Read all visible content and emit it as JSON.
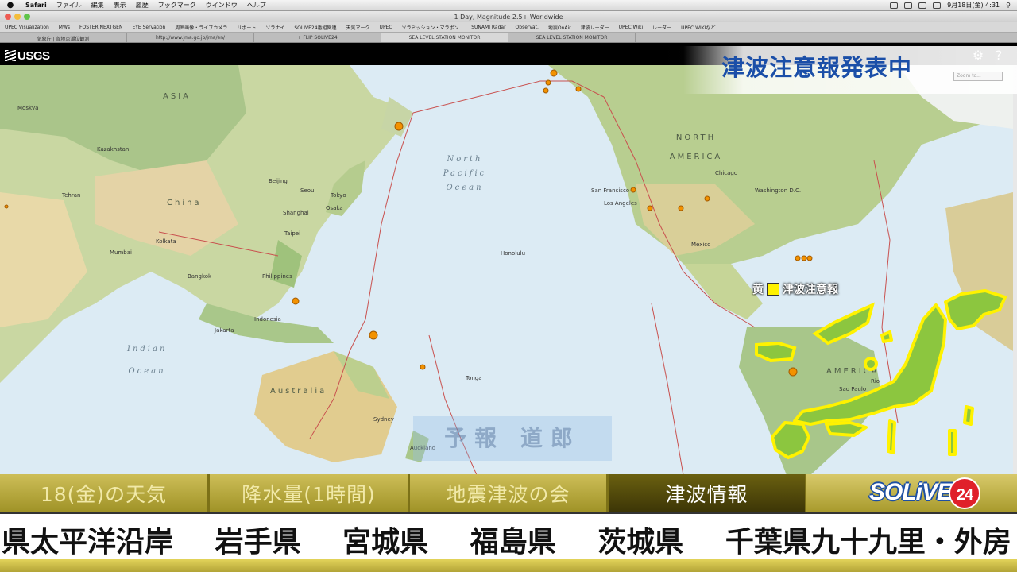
{
  "menubar": {
    "app": "Safari",
    "items": [
      "ファイル",
      "編集",
      "表示",
      "履歴",
      "ブックマーク",
      "ウインドウ",
      "ヘルプ"
    ],
    "clock": "9月18日(金) 4:31"
  },
  "window": {
    "title": "1 Day, Magnitude 2.5+ Worldwide"
  },
  "bookmarks": [
    "UPEC Visualization",
    "MWs",
    "FOSTER NEXTGEN",
    "EYE Servation",
    "周囲画像・ライブカメラ",
    "リポート",
    "ソラナイ",
    "SOLIVE24番組関連",
    "天気マーク",
    "UPEC",
    "ソラミッション・マラポン",
    "TSUNAMI Radar",
    "Observat.",
    "地震OnAir",
    "津波レーダー",
    "UPEC Wiki",
    "レーダー",
    "UPEC WIKIなど"
  ],
  "tabs": [
    "気象庁 | 各地点潮位観測",
    "http://www.jma.go.jp/jma/en/",
    "+ FLIP SOLIVE24",
    "SEA LEVEL STATION MONITOR",
    "SEA LEVEL STATION MONITOR"
  ],
  "usgs": {
    "logo": "USGS"
  },
  "overlay": {
    "headline": "津波注意報発表中",
    "zoom_placeholder": "Zoom to..."
  },
  "map": {
    "labels": {
      "asia": "ASIA",
      "china": "China",
      "north_america": "NORTH AMERICA",
      "australia": "Australia",
      "north_pacific": "North Pacific Ocean",
      "indian_ocean": "Indian Ocean",
      "south_america": "AMERICA"
    },
    "cities": [
      "Moskva",
      "Kazakhstan",
      "Tehran",
      "Mumbai",
      "Kolkata",
      "Beijing",
      "Seoul",
      "Tokyo",
      "Osaka",
      "Shanghai",
      "Taipei",
      "Bangkok",
      "Philippines",
      "Jakarta",
      "Indonesia",
      "Honolulu",
      "Sydney",
      "Auckland",
      "Los Angeles",
      "San Francisco",
      "Chicago",
      "Washington D.C.",
      "Mexico",
      "Tonga",
      "Sao Paulo",
      "Rio"
    ]
  },
  "legend": {
    "prefix": "黄",
    "label": "津波注意報",
    "color": "#fff200"
  },
  "caster": "予報 道郎",
  "bottom_tabs": [
    {
      "label": "18(金)の天気",
      "active": false
    },
    {
      "label": "降水量(1時間)",
      "active": false
    },
    {
      "label": "地震津波の会",
      "active": false
    },
    {
      "label": "津波情報",
      "active": true
    }
  ],
  "brand": {
    "name": "SOLiVE",
    "badge": "24"
  },
  "ticker": {
    "items": [
      "県太平洋沿岸",
      "岩手県",
      "宮城県",
      "福島県",
      "茨城県",
      "千葉県九十九里・外房"
    ]
  },
  "colors": {
    "advisory_yellow": "#fff200",
    "headline_blue": "#1b4fa8",
    "ocean": "#dcebf4",
    "quake_marker": "#f39200"
  }
}
